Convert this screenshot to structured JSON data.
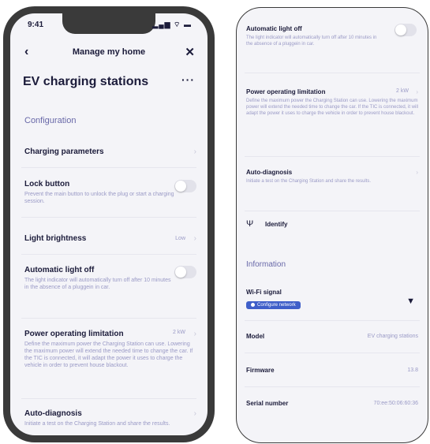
{
  "status_bar": {
    "time": "9:41",
    "icons": "▂▄▆ ⌔ ▬"
  },
  "nav": {
    "back_icon": "‹",
    "title": "Manage my home",
    "close_icon": "✕"
  },
  "page": {
    "title": "EV charging stations",
    "more_icon": "···"
  },
  "configuration": {
    "section_title": "Configuration",
    "charging_parameters": {
      "label": "Charging parameters"
    },
    "lock_button": {
      "label": "Lock button",
      "description": "Prevent the main button to unlock the plug or start a charging session.",
      "toggle_on": false
    },
    "light_brightness": {
      "label": "Light brightness",
      "value": "Low"
    },
    "automatic_light_off": {
      "label": "Automatic light off",
      "description": "The light indicator will automatically turn off after 10 minutes in the absence of a pluggein in car.",
      "toggle_on": false
    },
    "power_limitation": {
      "label": "Power operating limitation",
      "value": "2 kW",
      "description": "Define the maximum power the Charging Station can use. Lowering the maximum power will extend the needed time to change the car. If the TIC is connected, it will adapt the power it uses to charge the vehicle in order to prevent house blackout."
    },
    "auto_diagnosis": {
      "label": "Auto-diagnosis",
      "description": "Initiate a test on the Charging Station and share the results."
    },
    "identify": {
      "label": "Identify",
      "icon": "Ψ"
    }
  },
  "information": {
    "section_title": "Information",
    "wifi": {
      "label": "Wi-Fi signal",
      "badge": "Configure network",
      "icon": "▼"
    },
    "model": {
      "label": "Model",
      "value": "EV charging stations"
    },
    "firmware": {
      "label": "Firmware",
      "value": "13.8"
    },
    "serial": {
      "label": "Serial number",
      "value": "70:ee:50:06:60:36"
    }
  },
  "chevron": "›",
  "colors": {
    "accent": "#3f5fc9",
    "section": "#6868a8",
    "muted": "#9a9ac6",
    "background": "#f4f4f8"
  }
}
